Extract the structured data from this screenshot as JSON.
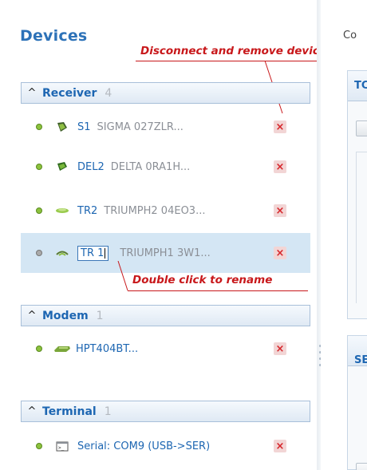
{
  "devices_panel": {
    "title": "Devices",
    "annotations": {
      "remove_hint": "Disconnect and remove device",
      "rename_hint": "Double click to rename"
    },
    "groups": [
      {
        "name": "Receiver",
        "count": "4",
        "items": [
          {
            "name": "S1",
            "model": "SIGMA 027ZLR...",
            "status": "connected",
            "icon": "receiver-dark-icon"
          },
          {
            "name": "DEL2",
            "model": "DELTA 0RA1H...",
            "status": "connected",
            "icon": "receiver-green-icon"
          },
          {
            "name": "TR2",
            "model": "TRIUMPH2 04EO3...",
            "status": "connected",
            "icon": "receiver-flat-icon"
          },
          {
            "name": "TR 1",
            "model": "TRIUMPH1 3W1...",
            "status": "disconnected",
            "icon": "receiver-wifi-icon",
            "editing": true
          }
        ]
      },
      {
        "name": "Modem",
        "count": "1",
        "items": [
          {
            "name": "HPT404BT...",
            "model": "",
            "status": "connected",
            "icon": "modem-icon"
          }
        ]
      },
      {
        "name": "Terminal",
        "count": "1",
        "items": [
          {
            "name": "Serial: COM9 (USB->SER)",
            "model": "",
            "status": "connected",
            "icon": "terminal-icon"
          }
        ]
      }
    ],
    "remove_symbol": "×"
  },
  "right_panel": {
    "top_label": "Co",
    "section1_label": "TC",
    "section2_label": "SE"
  },
  "colors": {
    "accent": "#1d66b2",
    "annotation": "#c8181b",
    "selected_row": "#d4e6f4",
    "status_green": "#8cc23d"
  }
}
